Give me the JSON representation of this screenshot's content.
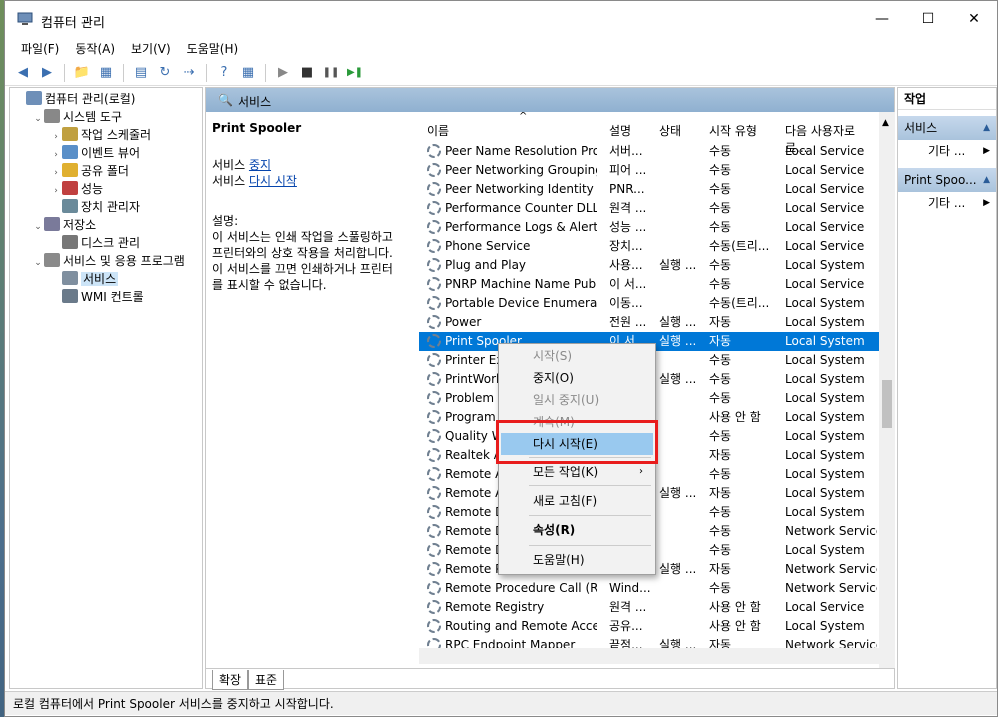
{
  "window": {
    "title": "컴퓨터 관리",
    "controls": {
      "minimize": "—",
      "maximize": "☐",
      "close": "✕"
    }
  },
  "menubar": [
    "파일(F)",
    "동작(A)",
    "보기(V)",
    "도움말(H)"
  ],
  "toolbar": {
    "icons": [
      "back-arrow-icon",
      "forward-arrow-icon",
      "up-folder-icon",
      "show-hide-tree-icon",
      "properties-icon",
      "refresh-icon",
      "export-icon",
      "help-icon",
      "show-hide-action-pane-icon",
      "start-service-icon",
      "stop-service-icon",
      "pause-service-icon",
      "restart-service-icon"
    ],
    "glyphs": [
      "◀",
      "▶",
      "📁",
      "▦",
      "▤",
      "↻",
      "⇢",
      "?",
      "▦",
      "▶",
      "■",
      "❚❚",
      "▶❚"
    ]
  },
  "tree": [
    {
      "label": "컴퓨터 관리(로컬)",
      "depth": 0,
      "toggle": "",
      "icon_color": "#6e8fb8"
    },
    {
      "label": "시스템 도구",
      "depth": 1,
      "toggle": "⌄",
      "icon_color": "#888"
    },
    {
      "label": "작업 스케줄러",
      "depth": 2,
      "toggle": "›",
      "icon_color": "#c0a040"
    },
    {
      "label": "이벤트 뷰어",
      "depth": 2,
      "toggle": "›",
      "icon_color": "#5a8fc8"
    },
    {
      "label": "공유 폴더",
      "depth": 2,
      "toggle": "›",
      "icon_color": "#e0b030"
    },
    {
      "label": "성능",
      "depth": 2,
      "toggle": "›",
      "icon_color": "#c04040"
    },
    {
      "label": "장치 관리자",
      "depth": 2,
      "toggle": "",
      "icon_color": "#6a8a9a"
    },
    {
      "label": "저장소",
      "depth": 1,
      "toggle": "⌄",
      "icon_color": "#7a7a9a"
    },
    {
      "label": "디스크 관리",
      "depth": 2,
      "toggle": "",
      "icon_color": "#777"
    },
    {
      "label": "서비스 및 응용 프로그램",
      "depth": 1,
      "toggle": "⌄",
      "icon_color": "#8a8a8a"
    },
    {
      "label": "서비스",
      "depth": 2,
      "toggle": "",
      "icon_color": "#7f8f9f",
      "selected": true
    },
    {
      "label": "WMI 컨트롤",
      "depth": 2,
      "toggle": "",
      "icon_color": "#6a7a8a"
    }
  ],
  "services_header": "서비스",
  "detail": {
    "service_name": "Print Spooler",
    "action1_prefix": "서비스 ",
    "action1_link": "중지",
    "action2_prefix": "서비스 ",
    "action2_link": "다시 시작",
    "desc_label": "설명:",
    "desc_lines": [
      "이 서비스는 인쇄 작업을 스풀링하고",
      "프린터와의 상호 작용을 처리합니다.",
      "이 서비스를 끄면 인쇄하거나 프린터",
      "를 표시할 수 없습니다."
    ]
  },
  "columns": [
    "이름",
    "설명",
    "상태",
    "시작 유형",
    "다음 사용자로 로..."
  ],
  "services": [
    [
      "Peer Name Resolution Prot...",
      "서버...",
      "",
      "수동",
      "Local Service"
    ],
    [
      "Peer Networking Grouping",
      "피어 ...",
      "",
      "수동",
      "Local Service"
    ],
    [
      "Peer Networking Identity ...",
      "PNR...",
      "",
      "수동",
      "Local Service"
    ],
    [
      "Performance Counter DLL ...",
      "원격 ...",
      "",
      "수동",
      "Local Service"
    ],
    [
      "Performance Logs & Alerts",
      "성능 ...",
      "",
      "수동",
      "Local Service"
    ],
    [
      "Phone Service",
      "장치...",
      "",
      "수동(트리...",
      "Local Service"
    ],
    [
      "Plug and Play",
      "사용...",
      "실행 ...",
      "수동",
      "Local System"
    ],
    [
      "PNRP Machine Name Publi...",
      "이 서...",
      "",
      "수동",
      "Local Service"
    ],
    [
      "Portable Device Enumerato...",
      "이동...",
      "",
      "수동(트리...",
      "Local System"
    ],
    [
      "Power",
      "전원 ...",
      "실행 ...",
      "자동",
      "Local System"
    ],
    [
      "Print Spooler",
      "이 서...",
      "실행 ...",
      "자동",
      "Local System"
    ],
    [
      "Printer Exte",
      "",
      "",
      "수동",
      "Local System"
    ],
    [
      "PrintWorkf",
      "",
      "실행 ...",
      "수동",
      "Local System"
    ],
    [
      "Problem Re",
      "",
      "",
      "수동",
      "Local System"
    ],
    [
      "Program C",
      "",
      "",
      "사용 안 함",
      "Local System"
    ],
    [
      "Quality Wi",
      "",
      "",
      "수동",
      "Local System"
    ],
    [
      "Realtek Au",
      "",
      "",
      "자동",
      "Local System"
    ],
    [
      "Remote Ac",
      "",
      "",
      "수동",
      "Local System"
    ],
    [
      "Remote Ac",
      "",
      "실행 ...",
      "자동",
      "Local System"
    ],
    [
      "Remote De",
      "",
      "",
      "수동",
      "Local System"
    ],
    [
      "Remote De",
      "",
      "",
      "수동",
      "Network Service"
    ],
    [
      "Remote De",
      "",
      "",
      "수동",
      "Local System"
    ],
    [
      "Remote Pr",
      "",
      "실행 ...",
      "자동",
      "Network Service"
    ],
    [
      "Remote Procedure Call (RP...",
      "Wind...",
      "",
      "수동",
      "Network Service"
    ],
    [
      "Remote Registry",
      "원격 ...",
      "",
      "사용 안 함",
      "Local Service"
    ],
    [
      "Routing and Remote Access",
      "공유...",
      "",
      "사용 안 함",
      "Local System"
    ],
    [
      "RPC Endpoint Mapper",
      "끝점...",
      "실행 ...",
      "자동",
      "Network Service"
    ]
  ],
  "selected_index": 10,
  "tabs": [
    "확장",
    "표준"
  ],
  "actions": {
    "title": "작업",
    "group1": "서비스",
    "group1_more": "기타 ...",
    "group2": "Print Spoo...",
    "group2_more": "기타 ..."
  },
  "context_menu": [
    {
      "label": "시작(S)",
      "disabled": true
    },
    {
      "label": "중지(O)",
      "disabled": false
    },
    {
      "label": "일시 중지(U)",
      "disabled": true
    },
    {
      "label": "계속(M)",
      "disabled": true
    },
    {
      "label": "다시 시작(E)",
      "disabled": false,
      "highlighted": true
    },
    {
      "label": "모든 작업(K)",
      "disabled": false,
      "submenu": "›"
    },
    {
      "label": "새로 고침(F)",
      "disabled": false
    },
    {
      "label": "속성(R)",
      "disabled": false,
      "bold": true
    },
    {
      "label": "도움말(H)",
      "disabled": false
    }
  ],
  "status_text": "로컬 컴퓨터에서 Print Spooler 서비스를 중지하고 시작합니다.",
  "colors": {
    "selection": "#0078d7",
    "highlight": "#99c9ef",
    "callout": "#e81c1c"
  }
}
